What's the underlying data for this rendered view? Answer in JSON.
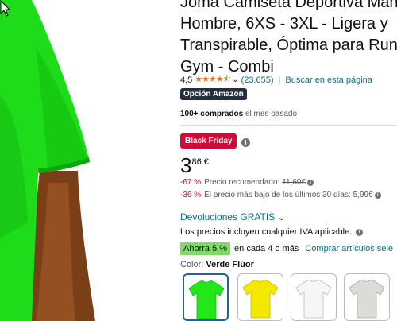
{
  "product": {
    "title_lines": [
      "Joma Camiseta Deportiva Manga",
      "Hombre, 6XS - 3XL - Ligera y",
      "Transpirable, Óptima para Runn",
      "Gym - Combi"
    ],
    "rating_value": "4,5",
    "stars": "★★★★⯪",
    "review_count": "(23.655)",
    "search_link": "Buscar en esta página",
    "badge": "Opción Amazon",
    "bought_bold": "100+ comprados",
    "bought_rest": " el mes pasado",
    "deal_badge": "Black Friday",
    "price_int": "3",
    "price_frac": "86 €",
    "discount1_pct": "-67 %",
    "discount1_text": "Precio recomendado:",
    "discount1_old": "11,60€",
    "discount2_pct": "-36 %",
    "discount2_text": "El precio más bajo de los últimos 30 días:",
    "discount2_old": "5,99€",
    "returns_label": "Devoluciones GRATIS",
    "vat_text": "Los precios incluyen cualquier IVA aplicable.",
    "save_badge": "Ahorra 5 %",
    "save_mid": "en cada 4 o más",
    "save_link": "Comprar artículos sele",
    "color_label": "Color:",
    "color_value": "Verde Flúor"
  },
  "swatches": [
    {
      "name": "Verde Flúor",
      "color": "#22e81a",
      "selected": true
    },
    {
      "name": "Amarillo",
      "color": "#f3e800",
      "selected": false
    },
    {
      "name": "Blanco",
      "color": "#f4f4f4",
      "selected": false
    },
    {
      "name": "Gris",
      "color": "#d8d8d2",
      "selected": false
    }
  ],
  "colors": {
    "shirt": "#1ee11c",
    "skin": "#8a4a1e",
    "link": "#007185",
    "deal": "#cc0c39"
  },
  "icons": {
    "info": "i",
    "chevron": "⌄"
  }
}
